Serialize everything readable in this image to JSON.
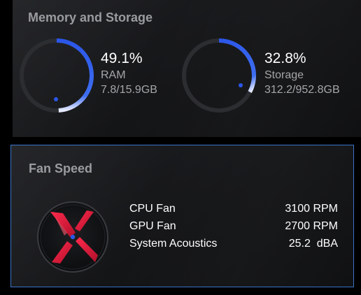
{
  "memory_storage": {
    "title": "Memory and Storage",
    "ram": {
      "percent_text": "49.1%",
      "percent": 49.1,
      "label": "RAM",
      "usage": "7.8/15.9GB"
    },
    "storage": {
      "percent_text": "32.8%",
      "percent": 32.8,
      "label": "Storage",
      "usage": "312.2/952.8GB"
    }
  },
  "fan_speed": {
    "title": "Fan Speed",
    "rows": [
      {
        "name": "CPU Fan",
        "value": "3100 RPM"
      },
      {
        "name": "GPU Fan",
        "value": "2700 RPM"
      },
      {
        "name": "System Acoustics",
        "value": "25.2  dBA"
      }
    ]
  },
  "colors": {
    "accent_blue": "#2b56e8",
    "gauge_track": "#2c2d30",
    "panel_border": "#3b73c9",
    "logo_red": "#e0193a"
  },
  "icons": {
    "fan_logo": "rog-x-logo-icon"
  }
}
